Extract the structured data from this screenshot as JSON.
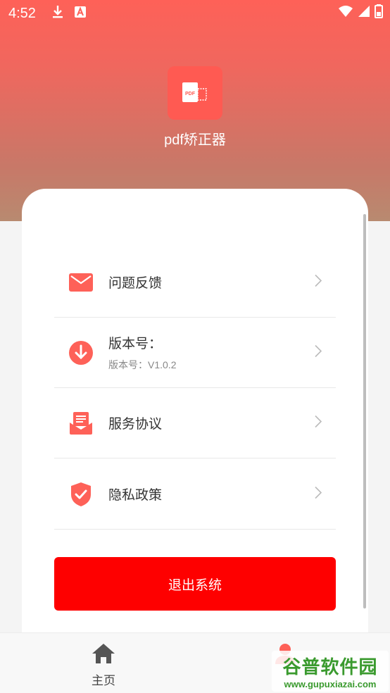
{
  "status_bar": {
    "time": "4:52",
    "left_icons": [
      "download-icon",
      "app-notification-icon"
    ],
    "right_icons": [
      "wifi-icon",
      "signal-icon",
      "battery-icon"
    ]
  },
  "app": {
    "name": "pdf矫正器",
    "logo_text": "PDF",
    "accent_color": "#fe6158"
  },
  "menu": [
    {
      "label": "问题反馈",
      "sub": "",
      "icon": "mail-icon"
    },
    {
      "label": "版本号：",
      "sub": "版本号：V1.0.2",
      "icon": "download-circle-icon"
    },
    {
      "label": "服务协议",
      "sub": "",
      "icon": "document-icon"
    },
    {
      "label": "隐私政策",
      "sub": "",
      "icon": "shield-check-icon"
    }
  ],
  "logout": {
    "label": "退出系统",
    "color": "#fe0000"
  },
  "bottom_nav": {
    "home": {
      "label": "主页",
      "icon": "home-icon"
    },
    "mine": {
      "label": "",
      "icon": "user-icon"
    }
  },
  "watermark": {
    "text": "谷普软件园",
    "url": "www.gupuxiazai.com"
  }
}
